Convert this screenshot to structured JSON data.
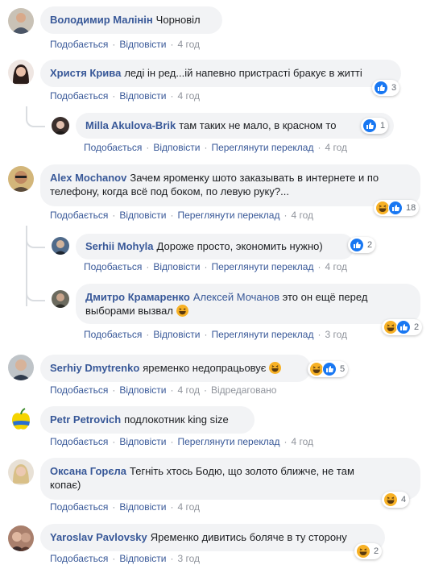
{
  "labels": {
    "like": "Подобається",
    "reply": "Відповісти",
    "translate": "Переглянути переклад",
    "edited": "Відредаговано"
  },
  "comments": [
    {
      "author": "Володимир Малінін",
      "text": "Чорновіл",
      "time": "4 год"
    },
    {
      "author": "Христя Крива",
      "text": "леді ін ред...ій напевно пристрасті бракує в житті",
      "time": "4 год",
      "reactions": "3"
    },
    {
      "author": "Milla Akulova-Brik",
      "text": "там таких не мало, в красном то",
      "time": "4 год",
      "reactions": "1"
    },
    {
      "author": "Alex Mochanov",
      "text1": "Зачем яроменку шото заказывать в интернете и по",
      "text2": "телефону, когда всё под боком, по левую руку?...",
      "time": "4 год",
      "reactions": "18"
    },
    {
      "author": "Serhii Mohyla",
      "text": "Дороже просто, экономить нужно)",
      "time": "4 год",
      "reactions": "2"
    },
    {
      "author": "Дмитро Крамаренко",
      "mention": "Алексей Мочанов",
      "text1": "это он ещё перед",
      "text2": "выборами вызвал",
      "time": "3 год",
      "reactions": "2"
    },
    {
      "author": "Serhiy Dmytrenko",
      "text": "яременко недопрацьовує",
      "time": "4 год",
      "reactions": "5"
    },
    {
      "author": "Petr Petrovich",
      "text": "подлокотник king size",
      "time": "4 год"
    },
    {
      "author": "Оксана Горєла",
      "text1": "Тегніть хтось Бодю, що золото ближче, не там",
      "text2": "копає)",
      "time": "4 год",
      "reactions": "4"
    },
    {
      "author": "Yaroslav Pavlovsky",
      "text": "Яременко дивитись боляче в ту сторону",
      "time": "3 год",
      "reactions": "2"
    }
  ],
  "colors": {
    "link": "#385898",
    "bubble": "#f2f3f5",
    "like_blue": "#1877f2",
    "haha_yellow": "#f7b125"
  },
  "icons": {
    "like": "like-reaction-icon",
    "haha": "haha-reaction-icon"
  }
}
